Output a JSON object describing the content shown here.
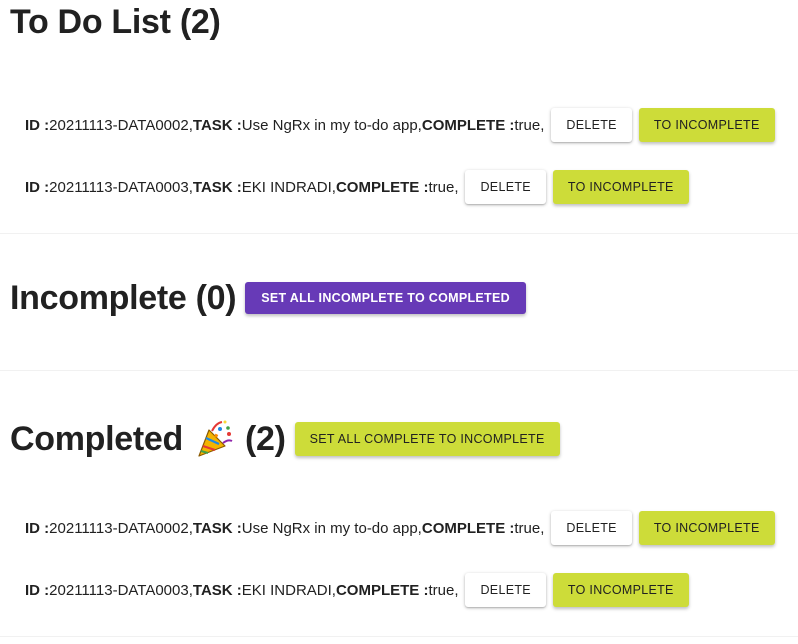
{
  "todo": {
    "title": "To Do List (2)",
    "items": [
      {
        "id_label": "ID :",
        "id": "20211113-DATA0002,",
        "task_label": "TASK :",
        "task": "Use NgRx in my to-do app,",
        "complete_label": "COMPLETE :",
        "complete": "true,",
        "delete_label": "DELETE",
        "toggle_label": "TO INCOMPLETE"
      },
      {
        "id_label": "ID :",
        "id": "20211113-DATA0003,",
        "task_label": "TASK :",
        "task": "EKI INDRADI,",
        "complete_label": "COMPLETE :",
        "complete": "true,",
        "delete_label": "DELETE",
        "toggle_label": "TO INCOMPLETE"
      }
    ]
  },
  "incomplete": {
    "title": "Incomplete (0)",
    "action_label": "SET ALL INCOMPLETE TO COMPLETED"
  },
  "completed": {
    "title_prefix": "Completed",
    "title_suffix": "(2)",
    "emoji_icon": "party-popper-icon",
    "action_label": "SET ALL COMPLETE TO INCOMPLETE",
    "items": [
      {
        "id_label": "ID :",
        "id": "20211113-DATA0002,",
        "task_label": "TASK :",
        "task": "Use NgRx in my to-do app,",
        "complete_label": "COMPLETE :",
        "complete": "true,",
        "delete_label": "DELETE",
        "toggle_label": "TO INCOMPLETE"
      },
      {
        "id_label": "ID :",
        "id": "20211113-DATA0003,",
        "task_label": "TASK :",
        "task": "EKI INDRADI,",
        "complete_label": "COMPLETE :",
        "complete": "true,",
        "delete_label": "DELETE",
        "toggle_label": "TO INCOMPLETE"
      }
    ]
  },
  "colors": {
    "primary_purple": "#673ab7",
    "accent_lime": "#cddc39",
    "text": "#212121"
  }
}
